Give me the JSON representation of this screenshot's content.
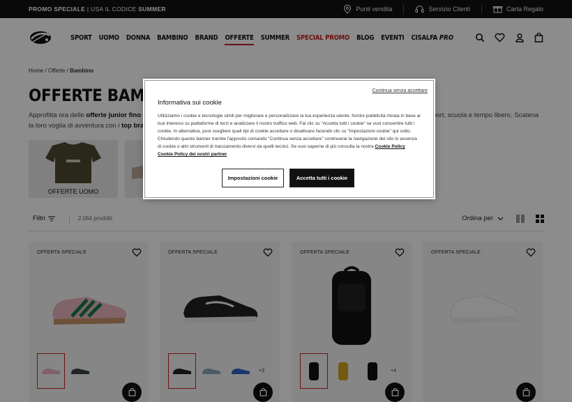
{
  "topbar": {
    "promo_label": "PROMO SPECIALE",
    "promo_text": "USA IL CODICE",
    "promo_code": "SUMMER",
    "links": [
      {
        "label": "Punti vendita",
        "icon": "map-pin-icon"
      },
      {
        "label": "Servizio Clienti",
        "icon": "headset-icon"
      },
      {
        "label": "Carta Regalo",
        "icon": "gift-icon"
      }
    ]
  },
  "nav": {
    "items": [
      "SPORT",
      "UOMO",
      "DONNA",
      "BAMBINO",
      "BRAND",
      "OFFERTE",
      "SUMMER",
      "SPECIAL PROMO",
      "BLOG",
      "EVENTI"
    ],
    "brand_prefix": "CISALFA",
    "brand_suffix": "PRO",
    "active": "OFFERTE",
    "highlight": "SPECIAL PROMO",
    "icons": [
      "search-icon",
      "heart-icon",
      "user-icon",
      "bag-icon"
    ]
  },
  "breadcrumb": {
    "items": [
      "Home",
      "Offerte",
      "Bambino"
    ],
    "separator": "/"
  },
  "page": {
    "title": "OFFERTE BAMBINO",
    "intro_a1": "Approfitta ora delle ",
    "intro_a_bold": "offerte junior fino al",
    "intro_b1": "la loro voglia di avventura con i ",
    "intro_b_bold": "top bran",
    "intro_c": "port, scuola e tempo libero. Scatena"
  },
  "categories": [
    {
      "label": "OFFERTE UOMO"
    }
  ],
  "filters": {
    "label": "Filtri",
    "count": "2.064 prodotti",
    "sort_label": "Ordina per"
  },
  "products": [
    {
      "badge": "OFFERTA SPECIALE",
      "more": ""
    },
    {
      "badge": "OFFERTA SPECIALE",
      "more": "+3"
    },
    {
      "badge": "OFFERTA SPECIALE",
      "more": "+4"
    },
    {
      "badge": "OFFERTA SPECIALE",
      "more": ""
    }
  ],
  "cookie": {
    "skip": "Continua senza accettare",
    "title": "Informativa sui cookie",
    "body": "Utilizziamo i cookie e tecnologie simili per migliorare e personalizzare la tua esperienza utente, fornire pubblicità mirata in base ai tuoi interessi su piattaforme di terzi e analizzare il nostro traffico web. Fai clic su \"Accetta tutti i cookie\" se vuoi consentire tutti i cookie. In alternativa, puoi scegliere quali tipi di cookie accettare o disattivare facendo clic su \"Impostazioni cookie\" qui sotto. Chiudendo questo banner tramite l'apposito comando \"Continua senza accettare\" continuerai la navigazione del sito in assenza di cookie o altri strumenti di tracciamento diversi da quelli tecnici. Se vuoi saperne di più consulta la nostra ",
    "link1": "Cookie Policy",
    "link2": "Cookie Policy dei nostri partner",
    "settings_button": "Impostazioni cookie",
    "accept_button": "Accetta tutti i cookie"
  },
  "colors": {
    "accent": "#c81e1e",
    "dark": "#111111"
  }
}
